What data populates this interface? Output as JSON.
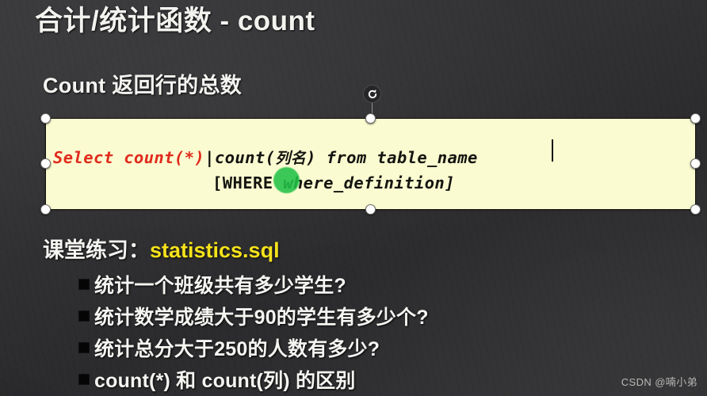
{
  "slide": {
    "title": "合计/统计函数 - count",
    "subtitle": "Count 返回行的总数",
    "background_color": "#313133"
  },
  "code_box": {
    "background_color": "#fbfbd1",
    "selected": true,
    "line1": {
      "red_part": "Select count(*)",
      "black_part_a": "|count(",
      "black_part_cjk": "列名",
      "black_part_b": ") from table_name"
    },
    "line2": {
      "text_a": "[WHERE ",
      "text_b": "where_definition]"
    },
    "red_color": "#e02b1c",
    "text_color": "#141410",
    "caret_visible": true,
    "cursor_marker_color": "#22c247"
  },
  "exercise": {
    "label": "课堂练习：",
    "file": "statistics.sql",
    "file_color": "#f5e21c",
    "items": [
      "统计一个班级共有多少学生?",
      "统计数学成绩大于90的学生有多少个?",
      "统计总分大于250的人数有多少?",
      "count(*) 和 count(列) 的区别"
    ]
  },
  "watermark": {
    "text": "CSDN @喃小弟"
  },
  "icons": {
    "rotate": "rotate-handle-icon"
  }
}
